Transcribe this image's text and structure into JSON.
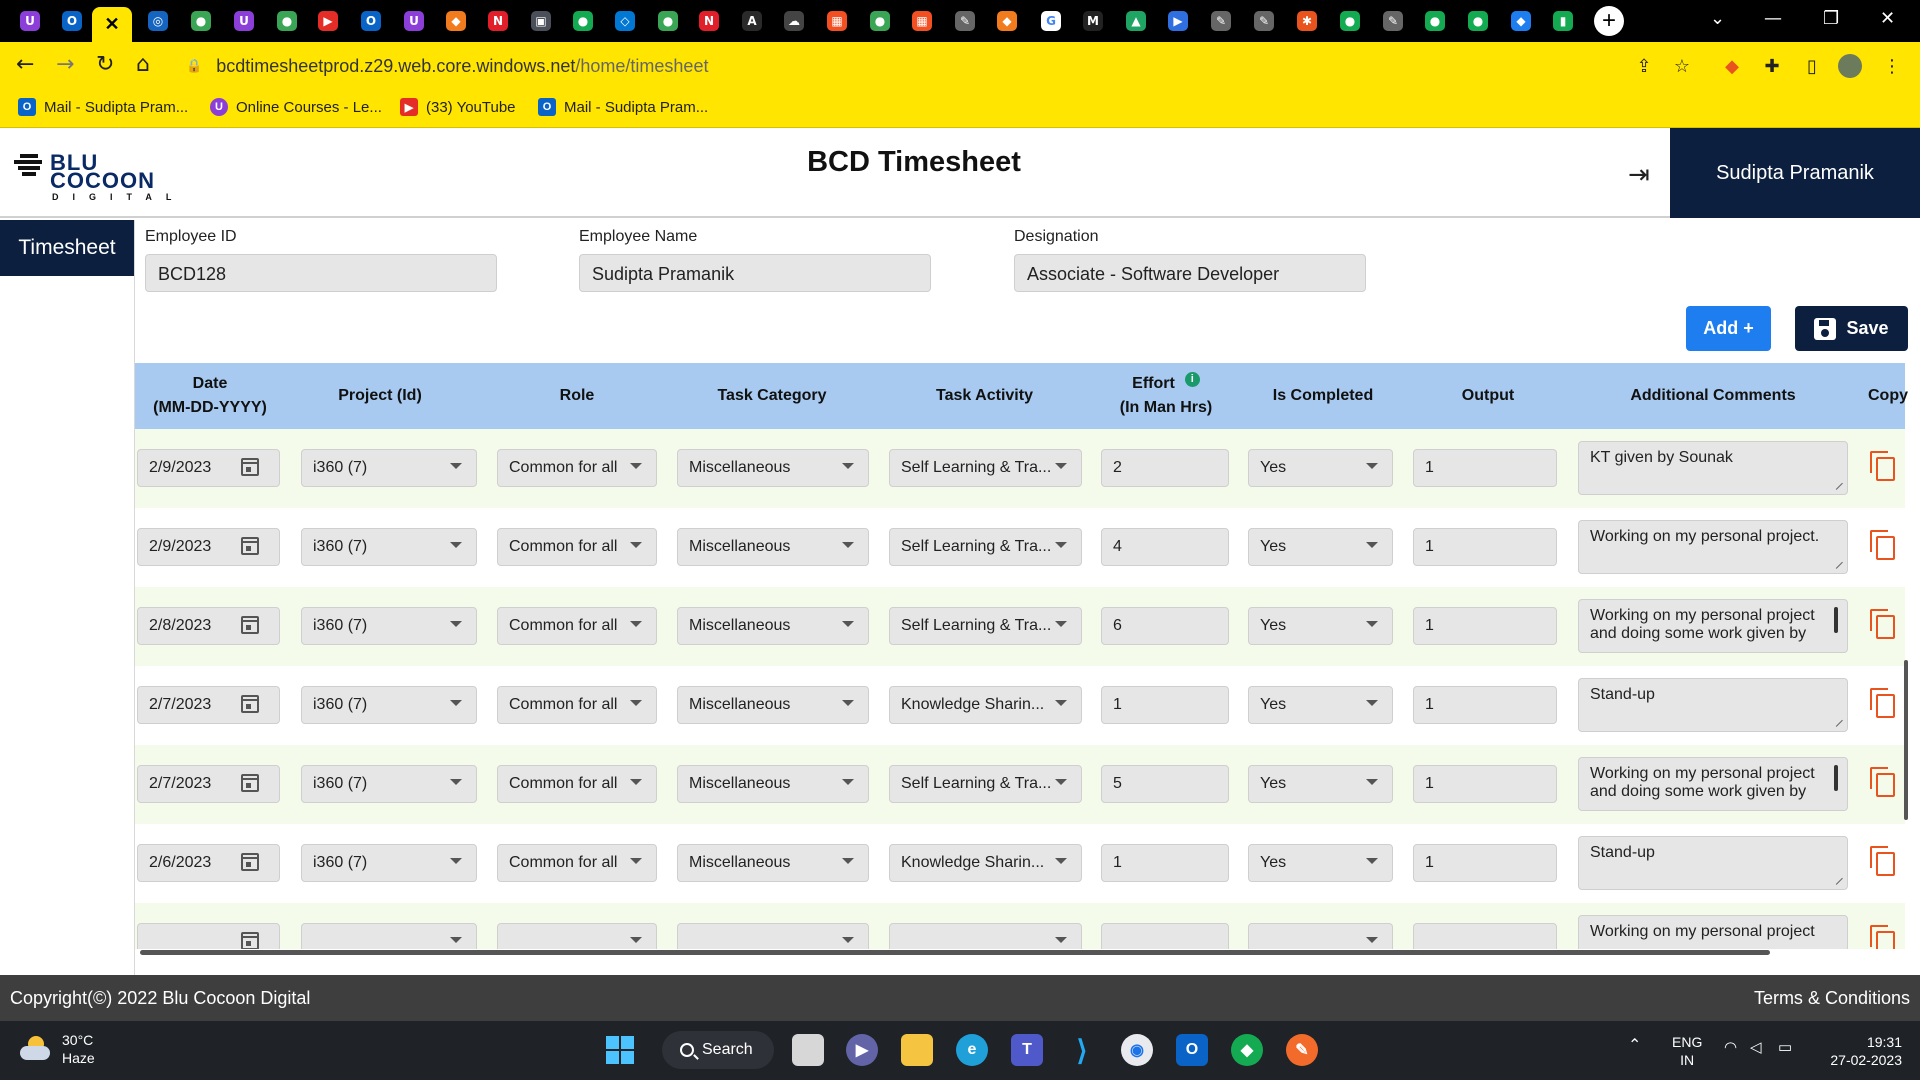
{
  "browser": {
    "url_host": "bcdtimesheetprod.z29.web.core.windows.net",
    "url_path": "/home/timesheet",
    "bookmarks": [
      {
        "label": "Mail - Sudipta Pram...",
        "icon": "outlook-icon",
        "color": "#0a64c8"
      },
      {
        "label": "Online Courses - Le...",
        "icon": "udemy-icon",
        "color": "#8b3fd8"
      },
      {
        "label": "(33) YouTube",
        "icon": "youtube-icon",
        "color": "#e52d27"
      },
      {
        "label": "Mail - Sudipta Pram...",
        "icon": "outlook-icon",
        "color": "#0a64c8"
      }
    ],
    "tabs": [
      {
        "icon": "udemy-icon",
        "color": "#8b3fd8",
        "glyph": "U"
      },
      {
        "icon": "outlook-icon",
        "color": "#0a64c8",
        "glyph": "O"
      },
      {
        "icon": "close-icon",
        "active": true,
        "glyph": "✕"
      },
      {
        "icon": "globe-icon",
        "color": "#1565c0",
        "glyph": "◎"
      },
      {
        "icon": "green-app-icon",
        "color": "#3aa655",
        "glyph": "●"
      },
      {
        "icon": "udemy-icon",
        "color": "#8b3fd8",
        "glyph": "U"
      },
      {
        "icon": "green-app-icon",
        "color": "#3aa655",
        "glyph": "●"
      },
      {
        "icon": "youtube-icon",
        "color": "#e52d27",
        "glyph": "▶"
      },
      {
        "icon": "outlook-icon",
        "color": "#0a64c8",
        "glyph": "O"
      },
      {
        "icon": "udemy-icon",
        "color": "#8b3fd8",
        "glyph": "U"
      },
      {
        "icon": "brave-icon",
        "color": "#f27b1e",
        "glyph": "◆"
      },
      {
        "icon": "notion-icon",
        "color": "#e01f2a",
        "glyph": "N"
      },
      {
        "icon": "app-icon",
        "color": "#4a4f5a",
        "glyph": "▣"
      },
      {
        "icon": "mongodb-icon",
        "color": "#13aa52",
        "glyph": "●"
      },
      {
        "icon": "azure-icon",
        "color": "#0078d4",
        "glyph": "◇"
      },
      {
        "icon": "green-app-icon",
        "color": "#3aa655",
        "glyph": "●"
      },
      {
        "icon": "notion-icon",
        "color": "#e01f2a",
        "glyph": "N"
      },
      {
        "icon": "angular-icon",
        "color": "#2a2a2a",
        "glyph": "A"
      },
      {
        "icon": "cloud-icon",
        "color": "#444",
        "glyph": "☁"
      },
      {
        "icon": "microsoft-icon",
        "color": "#f25022",
        "glyph": "▦"
      },
      {
        "icon": "green-app-icon",
        "color": "#3aa655",
        "glyph": "●"
      },
      {
        "icon": "microsoft-icon",
        "color": "#f25022",
        "glyph": "▦"
      },
      {
        "icon": "pen-icon",
        "color": "#666",
        "glyph": "✎"
      },
      {
        "icon": "brave-icon",
        "color": "#f27b1e",
        "glyph": "◆"
      },
      {
        "icon": "google-icon",
        "color": "#ffffff",
        "glyph": "G"
      },
      {
        "icon": "medium-icon",
        "color": "#222",
        "glyph": "M"
      },
      {
        "icon": "drive-icon",
        "color": "#1fa463",
        "glyph": "▲"
      },
      {
        "icon": "power-automate-icon",
        "color": "#2f6fe0",
        "glyph": "▶"
      },
      {
        "icon": "pen-icon",
        "color": "#666",
        "glyph": "✎"
      },
      {
        "icon": "pen-icon",
        "color": "#666",
        "glyph": "✎"
      },
      {
        "icon": "star-app-icon",
        "color": "#e8531e",
        "glyph": "✱"
      },
      {
        "icon": "mongodb-icon",
        "color": "#13aa52",
        "glyph": "●"
      },
      {
        "icon": "pen-icon",
        "color": "#666",
        "glyph": "✎"
      },
      {
        "icon": "mongodb-icon",
        "color": "#13aa52",
        "glyph": "●"
      },
      {
        "icon": "mongodb-icon",
        "color": "#13aa52",
        "glyph": "●"
      },
      {
        "icon": "blue-app-icon",
        "color": "#1e7ef0",
        "glyph": "◆"
      },
      {
        "icon": "mongodb-icon",
        "color": "#13aa52",
        "glyph": "▮"
      }
    ]
  },
  "app": {
    "logo_line1": "BLU",
    "logo_line2": "COCOON",
    "logo_line3": "DIGITAL",
    "title": "BCD Timesheet",
    "user_name": "Sudipta Pramanik",
    "sidebar_item": "Timesheet"
  },
  "employee": {
    "id_label": "Employee ID",
    "id_value": "BCD128",
    "name_label": "Employee Name",
    "name_value": "Sudipta Pramanik",
    "designation_label": "Designation",
    "designation_value": "Associate - Software Developer"
  },
  "actions": {
    "add_label": "Add +",
    "save_label": "Save"
  },
  "table": {
    "headers": {
      "date_line1": "Date",
      "date_line2": "(MM-DD-YYYY)",
      "project": "Project (Id)",
      "role": "Role",
      "task_category": "Task Category",
      "task_activity": "Task Activity",
      "effort_line1": "Effort",
      "effort_line2": "(In Man Hrs)",
      "is_completed": "Is Completed",
      "output": "Output",
      "additional_comments": "Additional Comments",
      "copy": "Copy"
    },
    "rows": [
      {
        "date": "2/9/2023",
        "project": "i360 (7)",
        "role": "Common for all",
        "category": "Miscellaneous",
        "activity": "Self Learning & Tra...",
        "effort": "2",
        "completed": "Yes",
        "output": "1",
        "comment": "KT given by Sounak"
      },
      {
        "date": "2/9/2023",
        "project": "i360 (7)",
        "role": "Common for all",
        "category": "Miscellaneous",
        "activity": "Self Learning & Tra...",
        "effort": "4",
        "completed": "Yes",
        "output": "1",
        "comment": "Working on my personal project."
      },
      {
        "date": "2/8/2023",
        "project": "i360 (7)",
        "role": "Common for all",
        "category": "Miscellaneous",
        "activity": "Self Learning & Tra...",
        "effort": "6",
        "completed": "Yes",
        "output": "1",
        "comment": "Working on my personal project and doing some work given by"
      },
      {
        "date": "2/7/2023",
        "project": "i360 (7)",
        "role": "Common for all",
        "category": "Miscellaneous",
        "activity": "Knowledge Sharin...",
        "effort": "1",
        "completed": "Yes",
        "output": "1",
        "comment": "Stand-up"
      },
      {
        "date": "2/7/2023",
        "project": "i360 (7)",
        "role": "Common for all",
        "category": "Miscellaneous",
        "activity": "Self Learning & Tra...",
        "effort": "5",
        "completed": "Yes",
        "output": "1",
        "comment": "Working on my personal project and doing some work given by"
      },
      {
        "date": "2/6/2023",
        "project": "i360 (7)",
        "role": "Common for all",
        "category": "Miscellaneous",
        "activity": "Knowledge Sharin...",
        "effort": "1",
        "completed": "Yes",
        "output": "1",
        "comment": "Stand-up"
      },
      {
        "date": "",
        "project": "",
        "role": "",
        "category": "",
        "activity": "",
        "effort": "",
        "completed": "",
        "output": "",
        "comment": "Working on my personal project"
      }
    ]
  },
  "footer": {
    "copyright": "Copyright(©) 2022 Blu Cocoon Digital",
    "terms": "Terms & Conditions"
  },
  "taskbar": {
    "temperature": "30°C",
    "condition": "Haze",
    "search_label": "Search",
    "language_line1": "ENG",
    "language_line2": "IN",
    "time": "19:31",
    "date": "27-02-2023"
  }
}
